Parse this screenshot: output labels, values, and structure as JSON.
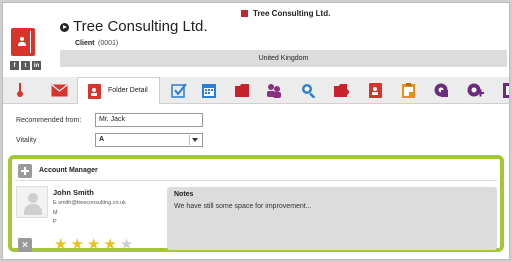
{
  "header": {
    "top_title": "Tree Consulting Ltd.",
    "company_name": "Tree Consulting Ltd.",
    "client_label": "Client",
    "client_number": "(0001)",
    "country": "United Kingdom"
  },
  "toolbar": {
    "active_tab_label": "Folder Detail"
  },
  "form": {
    "recommended_label": "Recommended from:",
    "recommended_value": "Mr. Jack",
    "vitality_label": "Vitality",
    "vitality_value": "A"
  },
  "account_manager": {
    "title": "Account Manager",
    "name": "John Smith",
    "email": "E smith@treeconsulting.co.uk",
    "line_m": "M",
    "line_p": "P",
    "rating": 4,
    "rating_max": 5,
    "notes_title": "Notes",
    "notes_text": "We have still some space for improvement..."
  },
  "colors": {
    "accent_green": "#a4c639",
    "brand_red": "#d9342b"
  }
}
